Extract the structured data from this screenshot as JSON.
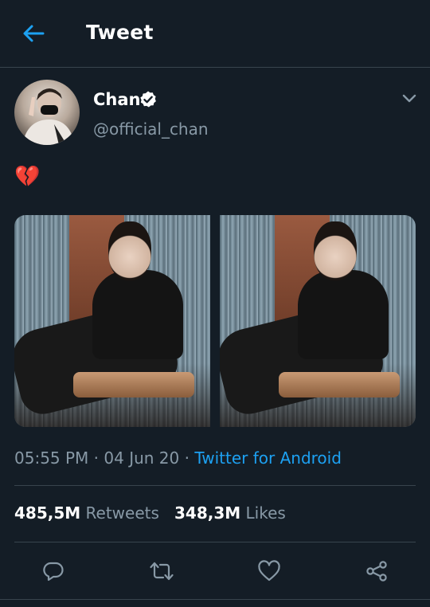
{
  "header": {
    "title": "Tweet",
    "back_icon": "arrow-left-icon"
  },
  "author": {
    "name": "Chan",
    "handle": "@official_chan",
    "verified": true,
    "avatar_icon": "avatar-photo"
  },
  "tweet": {
    "text": "💔",
    "media": [
      {
        "name": "photo-1"
      },
      {
        "name": "photo-2"
      }
    ],
    "time": "05:55 PM",
    "date": "04 Jun 20",
    "source": "Twitter for Android",
    "separator": "·"
  },
  "stats": {
    "retweets_count": "485,5M",
    "retweets_label": "Retweets",
    "likes_count": "348,3M",
    "likes_label": "Likes"
  },
  "actions": [
    "reply-icon",
    "retweet-icon",
    "like-icon",
    "share-icon"
  ],
  "colors": {
    "background": "#141d26",
    "accent": "#1da1f2",
    "secondary_text": "#8899a6",
    "divider": "#38444d"
  }
}
